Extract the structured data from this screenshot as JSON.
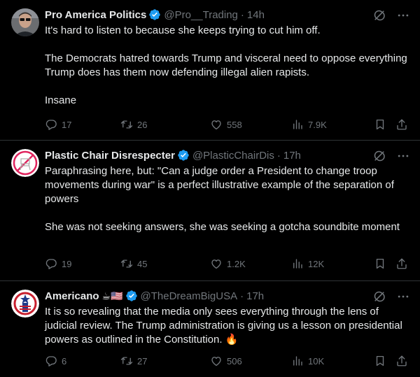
{
  "tweets": [
    {
      "name": "Pro America Politics",
      "handle": "@Pro__Trading",
      "dot": "·",
      "time": "14h",
      "emoji": "",
      "text": "It's hard to listen to because she keeps trying to cut him off.\n\nThe Democrats hatred towards Trump and visceral need to oppose everything Trump does has them now defending illegal alien rapists.\n\nInsane",
      "replies": "17",
      "retweets": "26",
      "likes": "558",
      "views": "7.9K"
    },
    {
      "name": "Plastic Chair Disrespecter",
      "handle": "@PlasticChairDis",
      "dot": "·",
      "time": "17h",
      "emoji": "",
      "text": "Paraphrasing here, but: \"Can a judge order a President to change troop movements during war\" is a perfect illustrative example of the separation of powers\n\nShe was not seeking answers, she was seeking a gotcha soundbite moment",
      "replies": "19",
      "retweets": "45",
      "likes": "1.2K",
      "views": "12K"
    },
    {
      "name": "Americano",
      "handle": "@TheDreamBigUSA",
      "dot": "·",
      "time": "17h",
      "emoji": "☕🇺🇸",
      "text": "It is so revealing that the media only sees everything through the lens of judicial review. The Trump administration is giving us a lesson on presidential powers as outlined in the Constitution. 🔥",
      "replies": "6",
      "retweets": "27",
      "likes": "506",
      "views": "10K"
    }
  ],
  "colors": {
    "background": "#000000",
    "text": "#e7e9ea",
    "muted": "#71767b",
    "verified": "#1d9bf0",
    "divider": "#2f3336"
  },
  "icons": [
    "grok-icon",
    "more-icon",
    "reply-icon",
    "retweet-icon",
    "like-icon",
    "views-icon",
    "bookmark-icon",
    "share-icon",
    "verified-badge-icon"
  ]
}
